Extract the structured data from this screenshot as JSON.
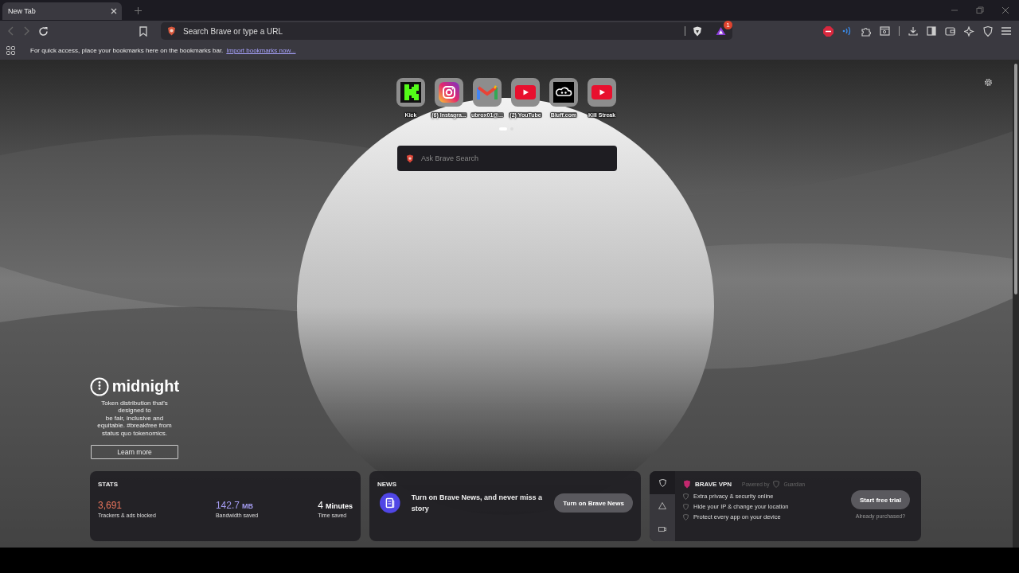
{
  "tabs": [
    {
      "title": "New Tab",
      "selected": true
    }
  ],
  "toolbar": {
    "address_placeholder": "Search Brave or type a URL",
    "rewards_badge": "1"
  },
  "bookmarks_bar": {
    "message": "For quick access, place your bookmarks here on the bookmarks bar.",
    "link": "Import bookmarks now..."
  },
  "top_sites": [
    {
      "kind": "kick",
      "label": "Kick"
    },
    {
      "kind": "instagram",
      "label": "(6) Instagra..."
    },
    {
      "kind": "gmail",
      "label": "ubrox01@..."
    },
    {
      "kind": "youtube",
      "label": "(2) YouTube"
    },
    {
      "kind": "bluff",
      "label": "Bluff.com"
    },
    {
      "kind": "youtube",
      "label": "Kill Streak"
    }
  ],
  "pages": [
    {
      "selected": true
    },
    {
      "selected": false
    }
  ],
  "search": {
    "placeholder": "Ask Brave Search"
  },
  "sponsor": {
    "brand": "midnight",
    "text": "Token distribution that's designed to\nbe fair, inclusive and equitable. #breakfree from status quo tokenomics.",
    "button": "Learn more"
  },
  "stats": {
    "title": "STATS",
    "items": [
      {
        "value": "3,691",
        "label": "Trackers & ads blocked",
        "color": "#e8745c"
      },
      {
        "value": "142.7",
        "unit": "MB",
        "label": "Bandwidth saved",
        "color": "#a49cf0"
      },
      {
        "value": "4",
        "unit": "Minutes",
        "label": "Time saved",
        "color": "#ffffff"
      }
    ]
  },
  "news": {
    "title": "NEWS",
    "text": "Turn on Brave News, and never miss a story",
    "button": "Turn on Brave News"
  },
  "vpn": {
    "title": "BRAVE VPN",
    "powered_by": "Powered by",
    "partner": "Guardian",
    "features": [
      "Extra privacy & security online",
      "Hide your IP & change your location",
      "Protect every app on your device"
    ],
    "button": "Start free trial",
    "link": "Already purchased?",
    "rail": [
      {
        "kind": "shield",
        "selected": true
      },
      {
        "kind": "triangle",
        "selected": false
      },
      {
        "kind": "camera",
        "selected": false
      }
    ]
  }
}
